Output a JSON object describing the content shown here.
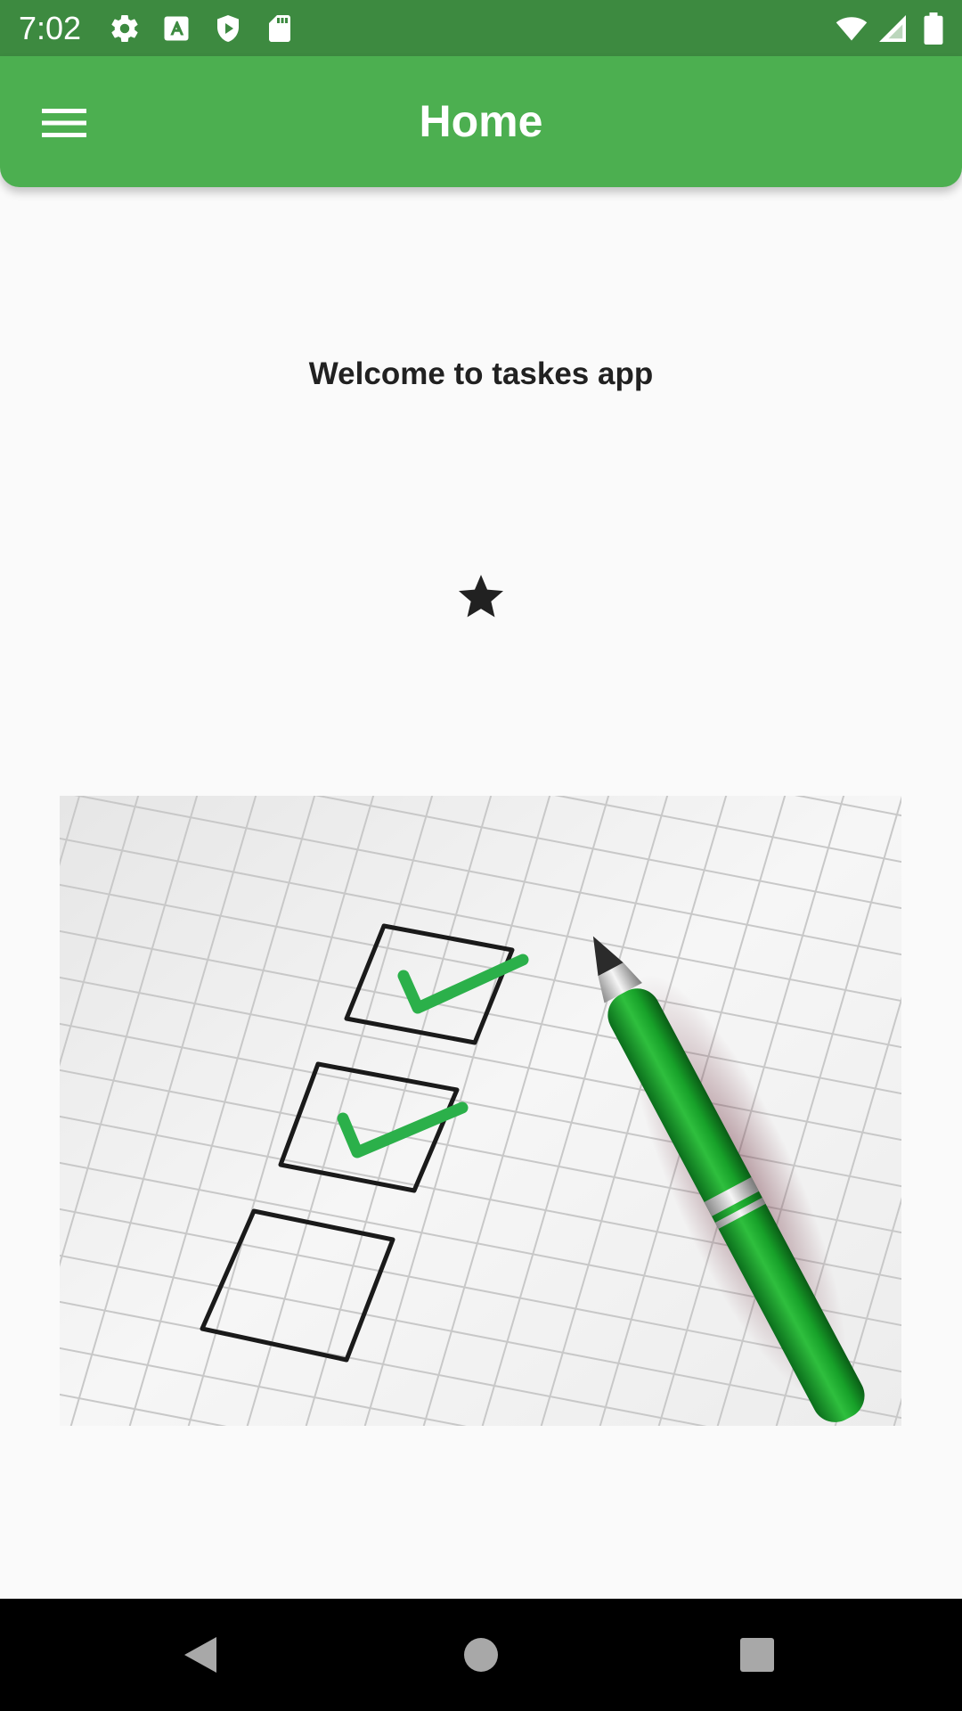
{
  "status_bar": {
    "time": "7:02",
    "left_icons": [
      "gear-icon",
      "text-a-icon",
      "shield-play-icon",
      "sd-card-icon"
    ],
    "right_icons": [
      "wifi-icon",
      "signal-icon",
      "battery-icon"
    ]
  },
  "app_bar": {
    "title": "Home",
    "menu_icon": "menu-icon",
    "color": "#4caf50"
  },
  "content": {
    "welcome_text": "Welcome to taskes app",
    "star_icon": "star-icon",
    "image": {
      "subject": "checklist-image"
    }
  },
  "nav_bar": {
    "buttons": [
      "back-icon",
      "home-icon",
      "recents-icon"
    ]
  },
  "colors": {
    "status_bar": "#3d8a40",
    "app_bar": "#4caf50",
    "background": "#fafafa",
    "text": "#212121"
  }
}
